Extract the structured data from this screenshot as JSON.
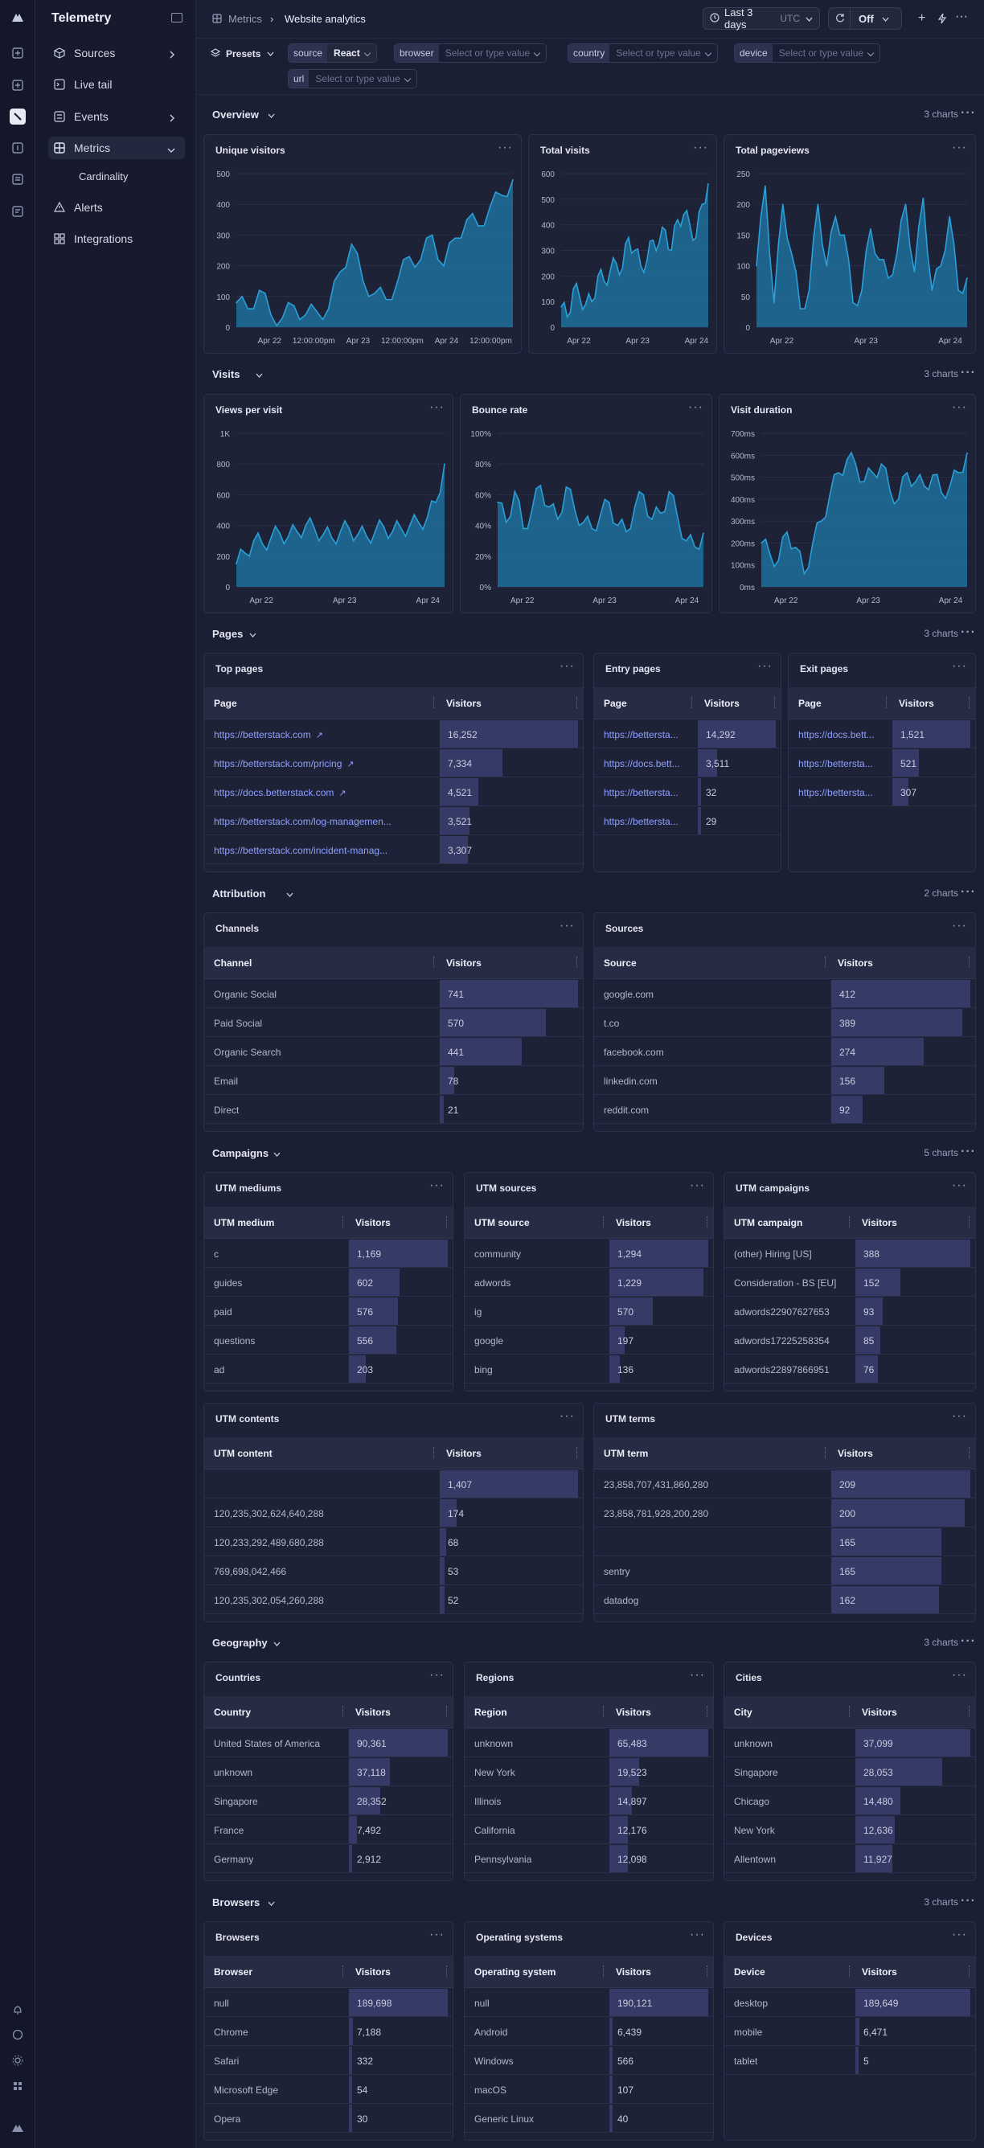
{
  "app": {
    "name": "Telemetry"
  },
  "sidebar": {
    "items": [
      {
        "label": "Sources",
        "icon": "cube-icon"
      },
      {
        "label": "Live tail",
        "icon": "terminal-icon"
      },
      {
        "label": "Events",
        "icon": "events-icon"
      },
      {
        "label": "Metrics",
        "icon": "dashboard-icon"
      },
      {
        "label": "Cardinality",
        "icon": ""
      },
      {
        "label": "Alerts",
        "icon": "alert-icon"
      },
      {
        "label": "Integrations",
        "icon": "puzzle-icon"
      }
    ]
  },
  "breadcrumb": {
    "parent": "Metrics",
    "current": "Website analytics"
  },
  "toolbar": {
    "time_range": "Last 3 days",
    "time_zone": "UTC",
    "refresh": "Off"
  },
  "filters": {
    "presets": "Presets",
    "items": [
      {
        "key": "source",
        "value": "React",
        "placeholder": ""
      },
      {
        "key": "browser",
        "value": "",
        "placeholder": "Select or type value"
      },
      {
        "key": "country",
        "value": "",
        "placeholder": "Select or type value"
      },
      {
        "key": "device",
        "value": "",
        "placeholder": "Select or type value"
      },
      {
        "key": "url",
        "value": "",
        "placeholder": "Select or type value"
      }
    ]
  },
  "sections": {
    "overview": {
      "title": "Overview",
      "count": "3 charts"
    },
    "visits": {
      "title": "Visits",
      "count": "3 charts"
    },
    "pages": {
      "title": "Pages",
      "count": "3 charts"
    },
    "attribution": {
      "title": "Attribution",
      "count": "2 charts"
    },
    "campaigns": {
      "title": "Campaigns",
      "count": "5 charts"
    },
    "geography": {
      "title": "Geography",
      "count": "3 charts"
    },
    "browsers": {
      "title": "Browsers",
      "count": "3 charts"
    }
  },
  "chart_data": [
    {
      "type": "area",
      "title": "Unique visitors",
      "ylim": [
        0,
        500
      ],
      "yticks": [
        "0",
        "100",
        "200",
        "300",
        "400",
        "500"
      ],
      "xticks": [
        "Apr 22",
        "12:00:00pm",
        "Apr 23",
        "12:00:00pm",
        "Apr 24",
        "12:00:00pm"
      ],
      "x": [
        0,
        3,
        6,
        9,
        12,
        15,
        18,
        21,
        24,
        27,
        30,
        33,
        36,
        39,
        42,
        45,
        48,
        51,
        54,
        57,
        60,
        63,
        66,
        69,
        72
      ],
      "values": [
        80,
        60,
        120,
        40,
        30,
        70,
        40,
        50,
        60,
        180,
        270,
        150,
        110,
        90,
        150,
        230,
        220,
        300,
        200,
        290,
        350,
        330,
        390,
        430,
        480
      ]
    },
    {
      "type": "area",
      "title": "Total visits",
      "ylim": [
        0,
        600
      ],
      "yticks": [
        "0",
        "100",
        "200",
        "300",
        "400",
        "500",
        "600"
      ],
      "xticks": [
        "Apr 22",
        "Apr 23",
        "Apr 24"
      ],
      "x": [
        0,
        3,
        6,
        9,
        12,
        15,
        18,
        21,
        24,
        27,
        30,
        33,
        36,
        39,
        42,
        45,
        48,
        51,
        54,
        57,
        60,
        63,
        66,
        69,
        72
      ],
      "values": [
        80,
        40,
        150,
        120,
        90,
        100,
        200,
        180,
        220,
        250,
        230,
        350,
        300,
        240,
        260,
        340,
        330,
        380,
        300,
        420,
        440,
        400,
        350,
        480,
        560
      ]
    },
    {
      "type": "area",
      "title": "Total pageviews",
      "ylim": [
        0,
        250
      ],
      "yticks": [
        "0",
        "50",
        "100",
        "150",
        "200",
        "250"
      ],
      "xticks": [
        "Apr 22",
        "Apr 23",
        "Apr 24"
      ],
      "x": [
        0,
        3,
        6,
        9,
        12,
        15,
        18,
        21,
        24,
        27,
        30,
        33,
        36,
        39,
        42,
        45,
        48,
        51,
        54,
        57,
        60,
        63,
        66,
        69,
        72
      ],
      "values": [
        100,
        230,
        40,
        200,
        120,
        30,
        60,
        200,
        100,
        180,
        150,
        40,
        60,
        160,
        110,
        80,
        120,
        200,
        90,
        210,
        60,
        100,
        180,
        60,
        80
      ]
    },
    {
      "type": "area",
      "title": "Views per visit",
      "ylim": [
        0,
        1000
      ],
      "yticks": [
        "0",
        "200",
        "400",
        "600",
        "800",
        "1K"
      ],
      "xticks": [
        "Apr 22",
        "Apr 23",
        "Apr 24"
      ],
      "x": [
        0,
        3,
        6,
        9,
        12,
        15,
        18,
        21,
        24,
        27,
        30,
        33,
        36,
        39,
        42,
        45,
        48,
        51,
        54,
        57,
        60,
        63,
        66,
        69,
        72
      ],
      "values": [
        150,
        220,
        300,
        280,
        320,
        350,
        330,
        360,
        400,
        380,
        340,
        320,
        360,
        380,
        340,
        330,
        360,
        390,
        360,
        380,
        400,
        420,
        450,
        550,
        800
      ]
    },
    {
      "type": "area",
      "title": "Bounce rate",
      "ylim": [
        0,
        100
      ],
      "yticks": [
        "0%",
        "20%",
        "40%",
        "60%",
        "80%",
        "100%"
      ],
      "xticks": [
        "Apr 22",
        "Apr 23",
        "Apr 24"
      ],
      "x": [
        0,
        3,
        6,
        9,
        12,
        15,
        18,
        21,
        24,
        27,
        30,
        33,
        36,
        39,
        42,
        45,
        48,
        51,
        54,
        57,
        60,
        63,
        66,
        69,
        72
      ],
      "values": [
        55,
        42,
        62,
        38,
        50,
        66,
        52,
        44,
        65,
        50,
        42,
        38,
        47,
        55,
        40,
        36,
        52,
        60,
        44,
        48,
        62,
        45,
        30,
        26,
        35
      ]
    },
    {
      "type": "area",
      "title": "Visit duration",
      "ylim": [
        0,
        700
      ],
      "yticks": [
        "0ms",
        "100ms",
        "200ms",
        "300ms",
        "400ms",
        "500ms",
        "600ms",
        "700ms"
      ],
      "xticks": [
        "Apr 22",
        "Apr 23",
        "Apr 24"
      ],
      "x": [
        0,
        3,
        6,
        9,
        12,
        15,
        18,
        21,
        24,
        27,
        30,
        33,
        36,
        39,
        42,
        45,
        48,
        51,
        54,
        57,
        60,
        63,
        66,
        69,
        72
      ],
      "values": [
        200,
        150,
        120,
        250,
        180,
        60,
        200,
        300,
        420,
        520,
        580,
        560,
        480,
        520,
        560,
        440,
        400,
        520,
        480,
        460,
        510,
        430,
        460,
        520,
        610
      ]
    }
  ],
  "tables": {
    "top_pages": {
      "title": "Top pages",
      "col1": "Page",
      "col2": "Visitors",
      "link": true,
      "rows": [
        [
          "https://betterstack.com",
          "16,252",
          16252
        ],
        [
          "https://betterstack.com/pricing",
          "7,334",
          7334
        ],
        [
          "https://docs.betterstack.com",
          "4,521",
          4521
        ],
        [
          "https://betterstack.com/log-managemen...",
          "3,521",
          3521
        ],
        [
          "https://betterstack.com/incident-manag...",
          "3,307",
          3307
        ]
      ]
    },
    "entry_pages": {
      "title": "Entry pages",
      "col1": "Page",
      "col2": "Visitors",
      "link": true,
      "rows": [
        [
          "https://bettersta...",
          "14,292",
          14292
        ],
        [
          "https://docs.bett...",
          "3,511",
          3511
        ],
        [
          "https://bettersta...",
          "32",
          32
        ],
        [
          "https://bettersta...",
          "29",
          29
        ]
      ]
    },
    "exit_pages": {
      "title": "Exit pages",
      "col1": "Page",
      "col2": "Visitors",
      "link": true,
      "rows": [
        [
          "https://docs.bett...",
          "1,521",
          1521
        ],
        [
          "https://bettersta...",
          "521",
          521
        ],
        [
          "https://bettersta...",
          "307",
          307
        ]
      ]
    },
    "channels": {
      "title": "Channels",
      "col1": "Channel",
      "col2": "Visitors",
      "rows": [
        [
          "Organic Social",
          "741",
          741
        ],
        [
          "Paid Social",
          "570",
          570
        ],
        [
          "Organic Search",
          "441",
          441
        ],
        [
          "Email",
          "78",
          78
        ],
        [
          "Direct",
          "21",
          21
        ]
      ]
    },
    "sources": {
      "title": "Sources",
      "col1": "Source",
      "col2": "Visitors",
      "rows": [
        [
          "google.com",
          "412",
          412
        ],
        [
          "t.co",
          "389",
          389
        ],
        [
          "facebook.com",
          "274",
          274
        ],
        [
          "linkedin.com",
          "156",
          156
        ],
        [
          "reddit.com",
          "92",
          92
        ]
      ]
    },
    "utm_mediums": {
      "title": "UTM mediums",
      "col1": "UTM medium",
      "col2": "Visitors",
      "rows": [
        [
          "c",
          "1,169",
          1169
        ],
        [
          "guides",
          "602",
          602
        ],
        [
          "paid",
          "576",
          576
        ],
        [
          "questions",
          "556",
          556
        ],
        [
          "ad",
          "203",
          203
        ]
      ]
    },
    "utm_sources": {
      "title": "UTM sources",
      "col1": "UTM source",
      "col2": "Visitors",
      "rows": [
        [
          "community",
          "1,294",
          1294
        ],
        [
          "adwords",
          "1,229",
          1229
        ],
        [
          "ig",
          "570",
          570
        ],
        [
          "google",
          "197",
          197
        ],
        [
          "bing",
          "136",
          136
        ]
      ]
    },
    "utm_campaigns": {
      "title": "UTM campaigns",
      "col1": "UTM campaign",
      "col2": "Visitors",
      "rows": [
        [
          "(other) Hiring [US]",
          "388",
          388
        ],
        [
          "Consideration - BS [EU]",
          "152",
          152
        ],
        [
          "adwords22907627653",
          "93",
          93
        ],
        [
          "adwords17225258354",
          "85",
          85
        ],
        [
          "adwords22897866951",
          "76",
          76
        ]
      ]
    },
    "utm_contents": {
      "title": "UTM contents",
      "col1": "UTM content",
      "col2": "Visitors",
      "rows": [
        [
          "",
          "1,407",
          1407
        ],
        [
          "120,235,302,624,640,288",
          "174",
          174
        ],
        [
          "120,233,292,489,680,288",
          "68",
          68
        ],
        [
          "769,698,042,466",
          "53",
          53
        ],
        [
          "120,235,302,054,260,288",
          "52",
          52
        ]
      ]
    },
    "utm_terms": {
      "title": "UTM terms",
      "col1": "UTM term",
      "col2": "Visitors",
      "rows": [
        [
          "23,858,707,431,860,280",
          "209",
          209
        ],
        [
          "23,858,781,928,200,280",
          "200",
          200
        ],
        [
          "",
          "165",
          165
        ],
        [
          "sentry",
          "165",
          165
        ],
        [
          "datadog",
          "162",
          162
        ]
      ]
    },
    "countries": {
      "title": "Countries",
      "col1": "Country",
      "col2": "Visitors",
      "rows": [
        [
          "United States of America",
          "90,361",
          90361
        ],
        [
          "unknown",
          "37,118",
          37118
        ],
        [
          "Singapore",
          "28,352",
          28352
        ],
        [
          "France",
          "7,492",
          7492
        ],
        [
          "Germany",
          "2,912",
          2912
        ]
      ]
    },
    "regions": {
      "title": "Regions",
      "col1": "Region",
      "col2": "Visitors",
      "rows": [
        [
          "unknown",
          "65,483",
          65483
        ],
        [
          "New York",
          "19,523",
          19523
        ],
        [
          "Illinois",
          "14,897",
          14897
        ],
        [
          "California",
          "12,176",
          12176
        ],
        [
          "Pennsylvania",
          "12,098",
          12098
        ]
      ]
    },
    "cities": {
      "title": "Cities",
      "col1": "City",
      "col2": "Visitors",
      "rows": [
        [
          "unknown",
          "37,099",
          37099
        ],
        [
          "Singapore",
          "28,053",
          28053
        ],
        [
          "Chicago",
          "14,480",
          14480
        ],
        [
          "New York",
          "12,636",
          12636
        ],
        [
          "Allentown",
          "11,927",
          11927
        ]
      ]
    },
    "browsers": {
      "title": "Browsers",
      "col1": "Browser",
      "col2": "Visitors",
      "rows": [
        [
          "null",
          "189,698",
          189698
        ],
        [
          "Chrome",
          "7,188",
          7188
        ],
        [
          "Safari",
          "332",
          332
        ],
        [
          "Microsoft Edge",
          "54",
          54
        ],
        [
          "Opera",
          "30",
          30
        ]
      ]
    },
    "operating_systems": {
      "title": "Operating systems",
      "col1": "Operating system",
      "col2": "Visitors",
      "rows": [
        [
          "null",
          "190,121",
          190121
        ],
        [
          "Android",
          "6,439",
          6439
        ],
        [
          "Windows",
          "566",
          566
        ],
        [
          "macOS",
          "107",
          107
        ],
        [
          "Generic Linux",
          "40",
          40
        ]
      ]
    },
    "devices": {
      "title": "Devices",
      "col1": "Device",
      "col2": "Visitors",
      "rows": [
        [
          "desktop",
          "189,649",
          189649
        ],
        [
          "mobile",
          "6,471",
          6471
        ],
        [
          "tablet",
          "5",
          5
        ]
      ]
    }
  },
  "colors": {
    "accent": "#2a9fd8",
    "bar": "#363a66",
    "link": "#8ea0ff"
  }
}
